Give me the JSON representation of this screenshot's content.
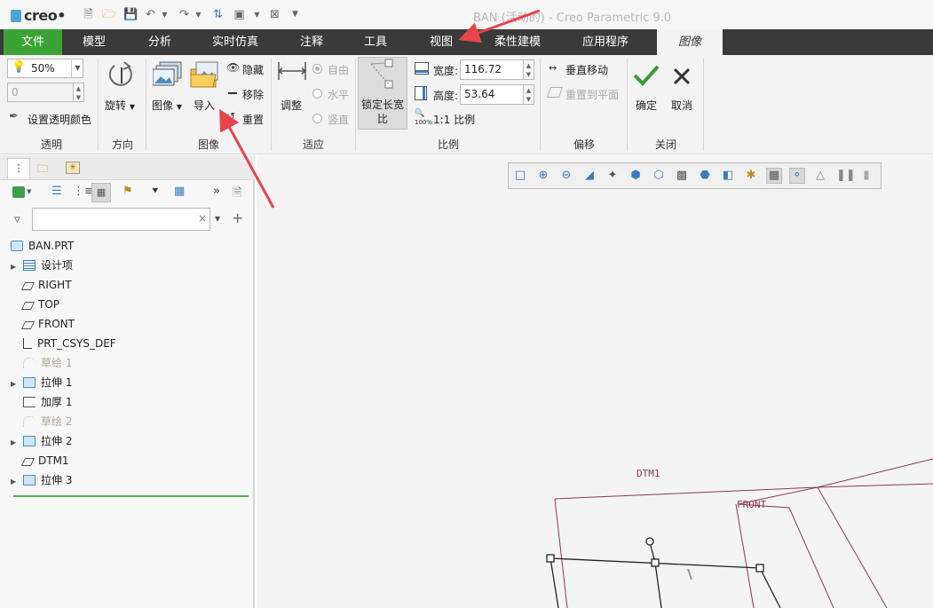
{
  "window": {
    "logo": "creo",
    "title": "BAN (活动的) - Creo Parametric 9.0"
  },
  "menu": {
    "tabs": [
      "文件",
      "模型",
      "分析",
      "实时仿真",
      "注释",
      "工具",
      "视图",
      "柔性建模",
      "应用程序",
      "图像"
    ]
  },
  "ribbon": {
    "transparency": {
      "value": "50%",
      "second_value": "0",
      "set_color": "设置透明颜色",
      "group": "透明"
    },
    "orientation": {
      "rotate": "旋转",
      "group": "方向"
    },
    "image": {
      "image": "图像",
      "import": "导入",
      "hide": "隐藏",
      "remove": "移除",
      "reset": "重置",
      "group": "图像"
    },
    "fit": {
      "adjust": "调整",
      "free": "自由",
      "horizontal": "水平",
      "vertical": "竖直",
      "group": "适应"
    },
    "scale": {
      "lock_ratio": "锁定长宽比",
      "width_label": "宽度:",
      "width_value": "116.72",
      "height_label": "高度:",
      "height_value": "53.64",
      "one_to_one": "1:1 比例",
      "group": "比例"
    },
    "offset": {
      "vertical_move": "垂直移动",
      "reset_plane": "重置到平面",
      "group": "偏移"
    },
    "close": {
      "ok": "确定",
      "cancel": "取消",
      "group": "关闭"
    }
  },
  "model_tree": {
    "root": "BAN.PRT",
    "items": [
      {
        "label": "设计项",
        "icon": "design-items-icon",
        "expand": true,
        "greyed": false
      },
      {
        "label": "RIGHT",
        "icon": "datum-plane-icon",
        "expand": false,
        "greyed": false
      },
      {
        "label": "TOP",
        "icon": "datum-plane-icon",
        "expand": false,
        "greyed": false
      },
      {
        "label": "FRONT",
        "icon": "datum-plane-icon",
        "expand": false,
        "greyed": false
      },
      {
        "label": "PRT_CSYS_DEF",
        "icon": "csys-icon",
        "expand": false,
        "greyed": false
      },
      {
        "label": "草绘 1",
        "icon": "sketch-icon",
        "expand": false,
        "greyed": true
      },
      {
        "label": "拉伸 1",
        "icon": "extrude-icon",
        "expand": true,
        "greyed": false
      },
      {
        "label": "加厚 1",
        "icon": "thicken-icon",
        "expand": false,
        "greyed": false
      },
      {
        "label": "草绘 2",
        "icon": "sketch-icon",
        "expand": false,
        "greyed": true
      },
      {
        "label": "拉伸 2",
        "icon": "extrude-icon",
        "expand": true,
        "greyed": false
      },
      {
        "label": "DTM1",
        "icon": "datum-plane-icon",
        "expand": false,
        "greyed": false
      },
      {
        "label": "拉伸 3",
        "icon": "extrude-icon",
        "expand": true,
        "greyed": false
      }
    ]
  },
  "viewport": {
    "datum_labels": [
      "DTM1",
      "FRONT"
    ],
    "datum_color": "#8b3a4a"
  },
  "colors": {
    "file_tab": "#3ba335",
    "menubar": "#3a3a3a",
    "annotation_arrow": "#e8444a",
    "ok_check": "#3a9a3a"
  }
}
